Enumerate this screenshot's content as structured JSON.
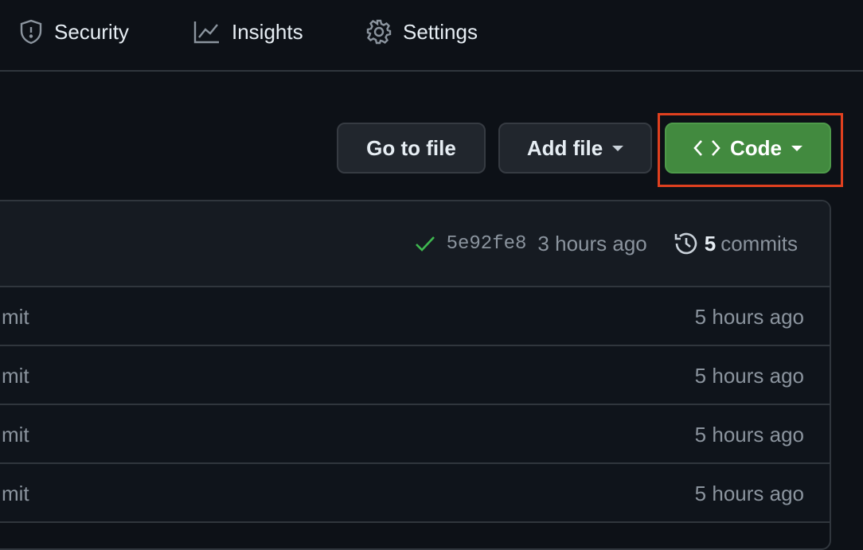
{
  "nav": {
    "items": [
      {
        "label": "Security",
        "icon": "shield-icon"
      },
      {
        "label": "Insights",
        "icon": "graph-icon"
      },
      {
        "label": "Settings",
        "icon": "gear-icon"
      }
    ]
  },
  "toolbar": {
    "go_to_file": "Go to file",
    "add_file": "Add file",
    "code": "Code"
  },
  "highlight_color": "#e0401f",
  "accent": "#428a3f",
  "latest_commit": {
    "status": "success",
    "sha": "5e92fe8",
    "time": "3 hours ago",
    "commit_count": "5",
    "commits_label": "commits"
  },
  "files": [
    {
      "message": "mit",
      "time": "5 hours ago"
    },
    {
      "message": "mit",
      "time": "5 hours ago"
    },
    {
      "message": "mit",
      "time": "5 hours ago"
    },
    {
      "message": "mit",
      "time": "5 hours ago"
    }
  ]
}
